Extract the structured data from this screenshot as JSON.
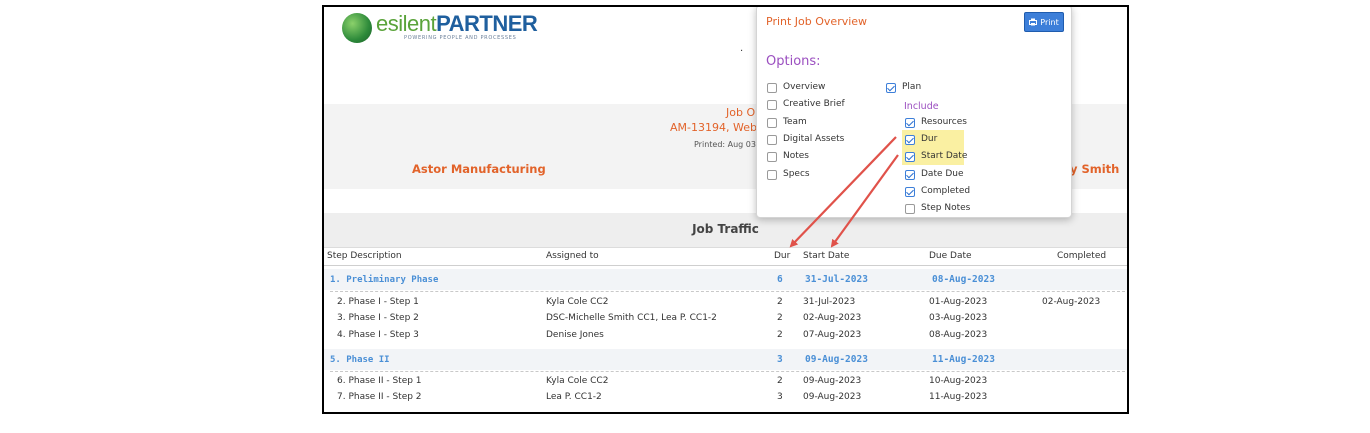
{
  "brand": {
    "logo_part1": "esilent",
    "logo_part2": "PARTNER",
    "tagline": "POWERING PEOPLE AND PROCESSES"
  },
  "header": {
    "title_fragment": "Job O",
    "subtitle_fragment": "AM-13194, Webs",
    "printed_fragment": "Printed: Aug 03",
    "client": "Astor Manufacturing",
    "owner_fragment": "ly Smith",
    "dot": "."
  },
  "traffic": {
    "title": "Job Traffic",
    "columns": {
      "step": "Step Description",
      "assigned": "Assigned to",
      "dur": "Dur",
      "start": "Start Date",
      "due": "Due Date",
      "completed": "Completed"
    },
    "phases": [
      {
        "label": "1. Preliminary Phase",
        "dur": "6",
        "start": "31-Jul-2023",
        "due": "08-Aug-2023",
        "steps": [
          {
            "step": "2. Phase I - Step 1",
            "assigned": "Kyla Cole CC2",
            "dur": "2",
            "start": "31-Jul-2023",
            "due": "01-Aug-2023",
            "completed": "02-Aug-2023"
          },
          {
            "step": "3. Phase I - Step 2",
            "assigned": "DSC-Michelle Smith CC1, Lea P. CC1-2",
            "dur": "2",
            "start": "02-Aug-2023",
            "due": "03-Aug-2023",
            "completed": ""
          },
          {
            "step": "4. Phase I - Step 3",
            "assigned": "Denise Jones",
            "dur": "2",
            "start": "07-Aug-2023",
            "due": "08-Aug-2023",
            "completed": ""
          }
        ]
      },
      {
        "label": "5. Phase II",
        "dur": "3",
        "start": "09-Aug-2023",
        "due": "11-Aug-2023",
        "steps": [
          {
            "step": "6. Phase II - Step 1",
            "assigned": "Kyla Cole CC2",
            "dur": "2",
            "start": "09-Aug-2023",
            "due": "10-Aug-2023",
            "completed": ""
          },
          {
            "step": "7. Phase II - Step 2",
            "assigned": "Lea P. CC1-2",
            "dur": "3",
            "start": "09-Aug-2023",
            "due": "11-Aug-2023",
            "completed": ""
          }
        ]
      }
    ]
  },
  "popup": {
    "title": "Print Job Overview",
    "print_label": "Print",
    "options_label": "Options:",
    "include_label": "Include",
    "left_options": [
      {
        "label": "Overview",
        "checked": false
      },
      {
        "label": "Creative Brief",
        "checked": false
      },
      {
        "label": "Team",
        "checked": false
      },
      {
        "label": "Digital Assets",
        "checked": false
      },
      {
        "label": "Notes",
        "checked": false
      },
      {
        "label": "Specs",
        "checked": false
      }
    ],
    "plan": {
      "label": "Plan",
      "checked": true
    },
    "include_options": [
      {
        "label": "Resources",
        "checked": true,
        "highlight": false
      },
      {
        "label": "Dur",
        "checked": true,
        "highlight": true
      },
      {
        "label": "Start Date",
        "checked": true,
        "highlight": true
      },
      {
        "label": "Date Due",
        "checked": true,
        "highlight": false
      },
      {
        "label": "Completed",
        "checked": true,
        "highlight": false
      },
      {
        "label": "Step Notes",
        "checked": false,
        "highlight": false
      }
    ]
  },
  "colors": {
    "accent": "#e2632a",
    "phase": "#4a8fd6",
    "purple": "#9b4fc0",
    "arrow": "#e0524a",
    "highlight": "#faf0a2"
  }
}
